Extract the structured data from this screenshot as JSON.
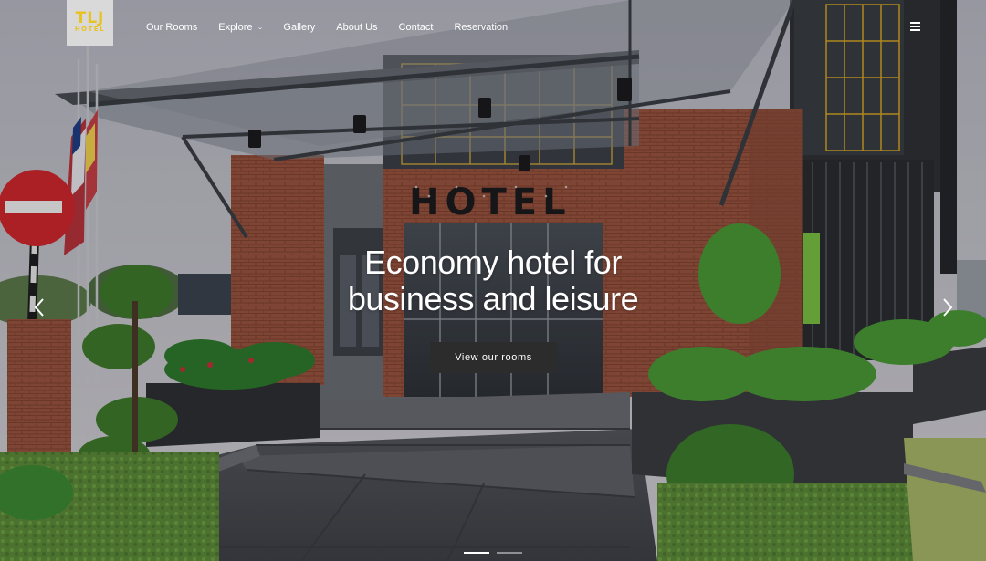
{
  "header": {
    "logo": {
      "text": "TLJ",
      "subtext": "HOTEL"
    },
    "nav": [
      {
        "label": "Our Rooms",
        "has_dropdown": false
      },
      {
        "label": "Explore",
        "has_dropdown": true
      },
      {
        "label": "Gallery",
        "has_dropdown": false
      },
      {
        "label": "About Us",
        "has_dropdown": false
      },
      {
        "label": "Contact",
        "has_dropdown": false
      },
      {
        "label": "Reservation",
        "has_dropdown": false
      }
    ],
    "menu_icon": "hamburger-icon"
  },
  "hero": {
    "headline_line1": "Economy hotel for",
    "headline_line2": "business and leisure",
    "cta_label": "View our rooms",
    "prev_icon": "chevron-left-icon",
    "next_icon": "chevron-right-icon",
    "slides": 2,
    "active_slide": 1,
    "building_sign": "HOTEL"
  },
  "colors": {
    "logo_text": "#e8c21e",
    "logo_bg": "#d9d9d9",
    "cta_bg": "#2c2c2c",
    "text": "#ffffff"
  }
}
